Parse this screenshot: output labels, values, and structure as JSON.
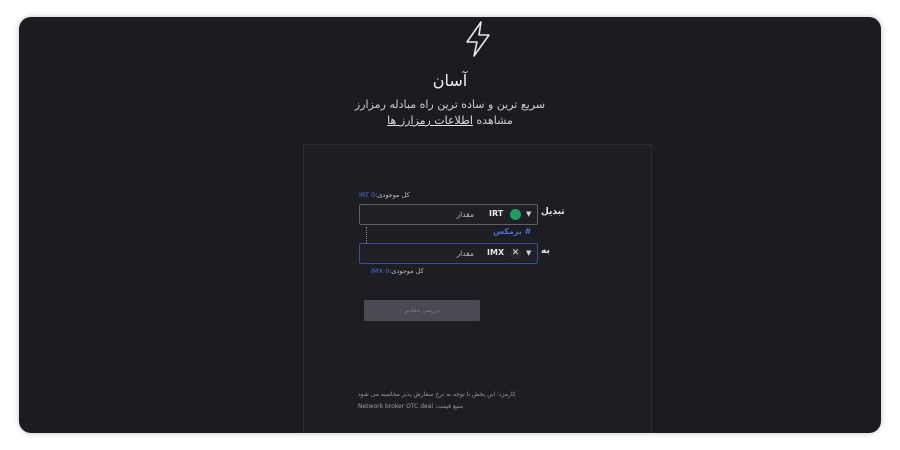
{
  "app": {
    "title": "آسان",
    "subtitle": "سریع ترین و ساده ترین راه مبادله رمزارز",
    "view_prefix": "مشاهده",
    "view_link": "اطلاعات رمزارز ها"
  },
  "exchange": {
    "from_balance_label": "کل موجودی:",
    "from_balance_value": "0 IRT",
    "from_label": "تبدیل",
    "from_currency": "IRT",
    "from_placeholder": "مقدار",
    "max_label": "# برمکس",
    "to_label": "به",
    "to_currency": "IMX",
    "to_placeholder": "مقدار",
    "to_balance_label": "کل موجودی:",
    "to_balance_value": "0 IMX",
    "submit_label": "بررسی مقادیر"
  },
  "footer": {
    "fee_note": "کارمزد: این بخش با توجه به نرخ سفارش پذیر محاسبه می شود",
    "price_source": "منبع قیمت: Network broker OTC deal"
  },
  "colors": {
    "accent": "#4d6fd6",
    "irt_coin": "#1c9e5f",
    "background": "#1b1c20"
  },
  "icons": {
    "logo": "lightning-bolt-icon",
    "irt": "irt-coin-icon",
    "imx": "imx-coin-icon",
    "dropdown": "chevron-down-icon"
  }
}
